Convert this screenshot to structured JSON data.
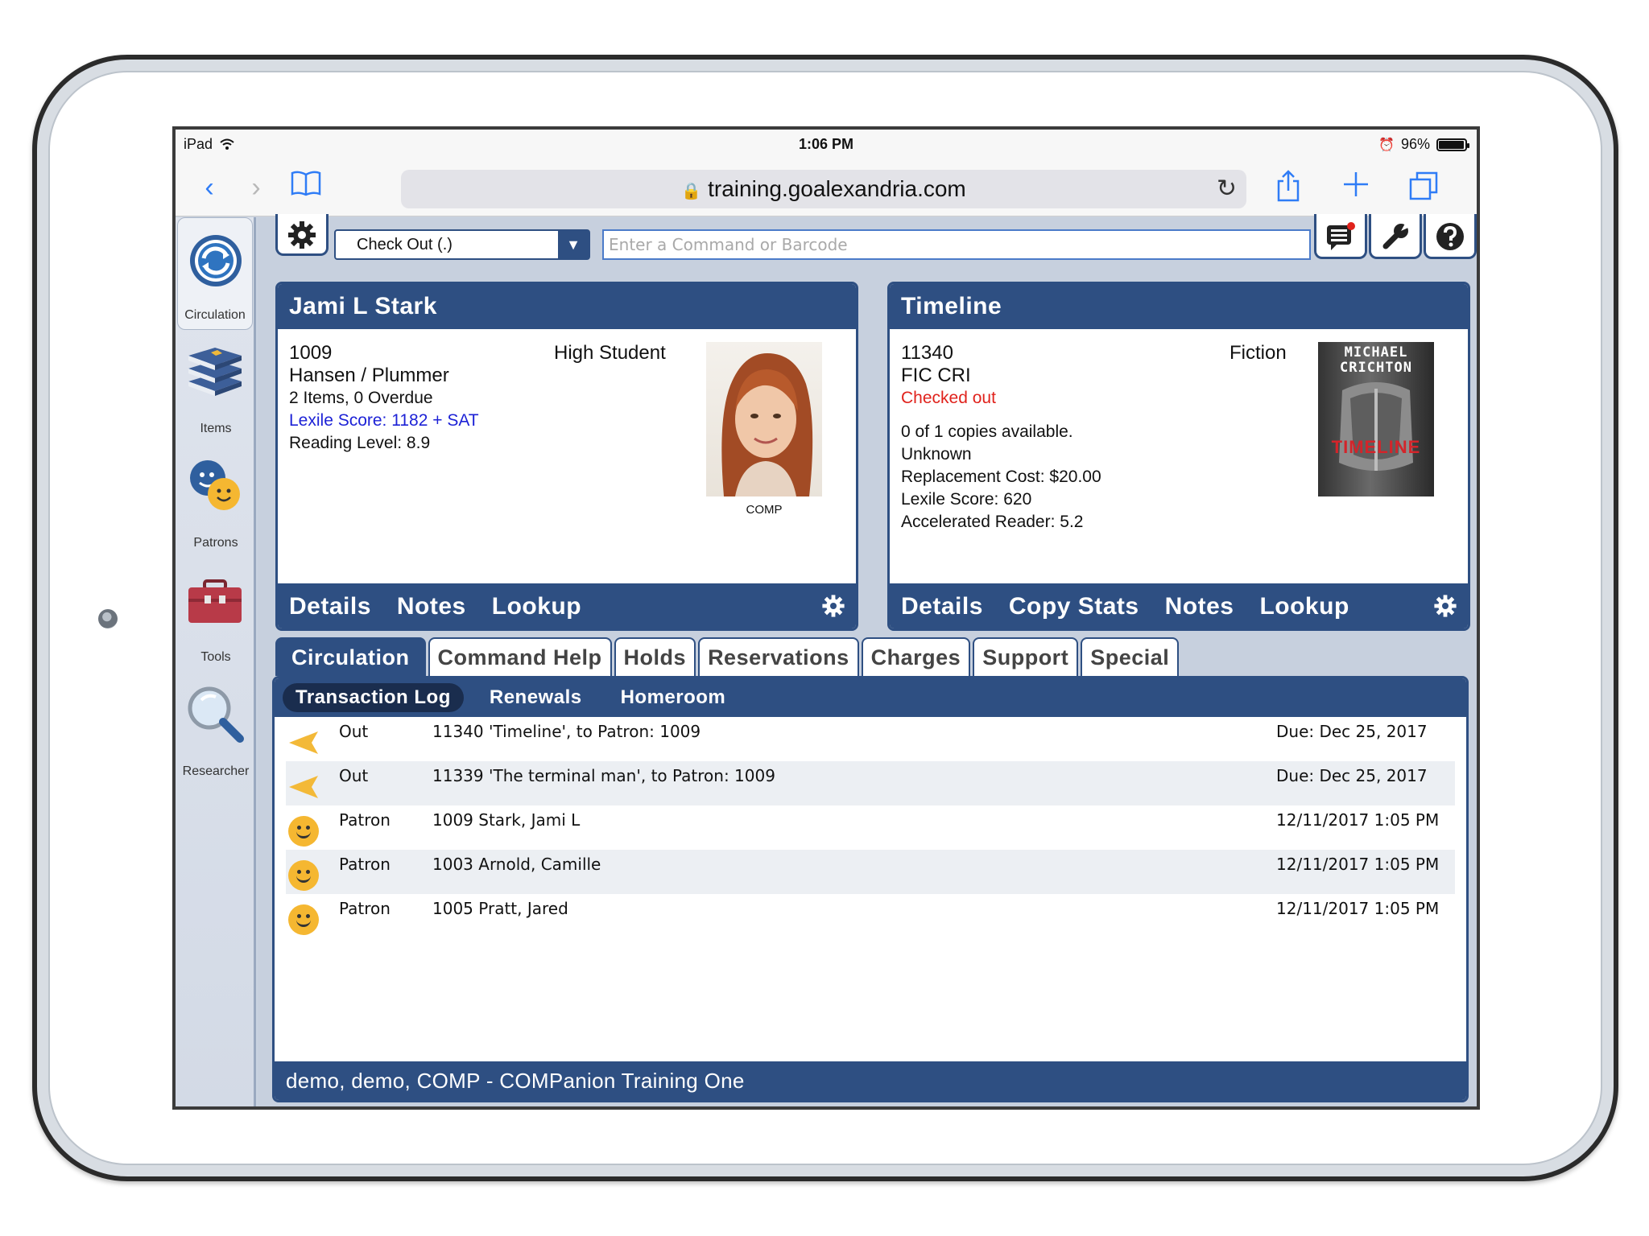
{
  "status_bar": {
    "device": "iPad",
    "time": "1:06 PM",
    "battery": "96%"
  },
  "browser": {
    "url": "training.goalexandria.com"
  },
  "sidebar": {
    "items": [
      {
        "label": "Circulation",
        "icon": "circulation-icon"
      },
      {
        "label": "Items",
        "icon": "books-icon"
      },
      {
        "label": "Patrons",
        "icon": "patrons-icon"
      },
      {
        "label": "Tools",
        "icon": "toolbox-icon"
      },
      {
        "label": "Researcher",
        "icon": "magnifier-icon"
      }
    ]
  },
  "command": {
    "mode": "Check Out (.)",
    "placeholder": "Enter a Command or Barcode"
  },
  "patron": {
    "name": "Jami L Stark",
    "barcode": "1009",
    "type": "High Student",
    "homeroom": "Hansen / Plummer",
    "items": "2 Items, 0 Overdue",
    "lexile": "Lexile Score: 1182 + SAT",
    "reading_level": "Reading Level: 8.9",
    "photo_caption": "COMP",
    "links": [
      "Details",
      "Notes",
      "Lookup"
    ]
  },
  "item": {
    "title": "Timeline",
    "barcode": "11340",
    "category": "Fiction",
    "call_number": "FIC CRI",
    "status": "Checked out",
    "copies": "0 of 1 copies available.",
    "location": "Unknown",
    "replacement_cost": "Replacement Cost: $20.00",
    "lexile": "Lexile Score: 620",
    "accelerated_reader": "Accelerated Reader: 5.2",
    "cover_author": "MICHAEL CRICHTON",
    "cover_title": "TIMELINE",
    "links": [
      "Details",
      "Copy Stats",
      "Notes",
      "Lookup"
    ]
  },
  "tabs": [
    "Circulation",
    "Command Help",
    "Holds",
    "Reservations",
    "Charges",
    "Support",
    "Special"
  ],
  "subtabs": [
    "Transaction Log",
    "Renewals",
    "Homeroom"
  ],
  "log": [
    {
      "type": "Out",
      "desc": "11340 'Timeline', to Patron: 1009",
      "date": "Due: Dec 25, 2017",
      "icon": "checkout-arrow-icon"
    },
    {
      "type": "Out",
      "desc": "11339 'The terminal man', to Patron: 1009",
      "date": "Due: Dec 25, 2017",
      "icon": "checkout-arrow-icon"
    },
    {
      "type": "Patron",
      "desc": "1009 Stark, Jami L",
      "date": "12/11/2017 1:05 PM",
      "icon": "smiley-icon"
    },
    {
      "type": "Patron",
      "desc": "1003 Arnold, Camille",
      "date": "12/11/2017 1:05 PM",
      "icon": "smiley-icon"
    },
    {
      "type": "Patron",
      "desc": "1005 Pratt, Jared",
      "date": "12/11/2017 1:05 PM",
      "icon": "smiley-icon"
    }
  ],
  "footer": "demo, demo, COMP - COMPanion Training One",
  "colors": {
    "panel_blue": "#2e4f82",
    "link_blue": "#1d22d6",
    "status_red": "#e0221c",
    "safari_blue": "#2f7cf6"
  }
}
